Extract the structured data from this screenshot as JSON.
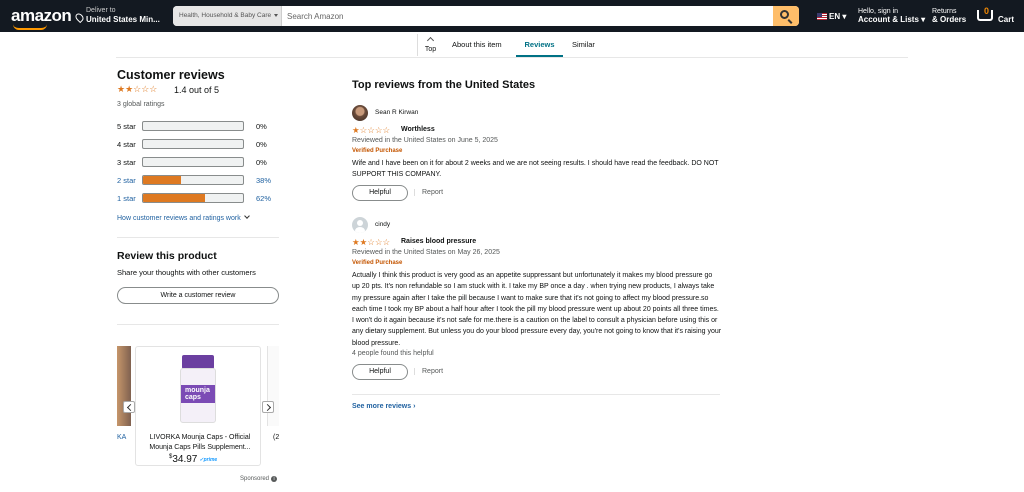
{
  "header": {
    "logo": "amazon",
    "deliver_line1": "Deliver to",
    "deliver_line2": "United States Min...",
    "search_category": "Health, Household & Baby Care",
    "search_placeholder": "Search Amazon",
    "language": "EN",
    "account_line1": "Hello, sign in",
    "account_line2": "Account & Lists",
    "orders_line1": "Returns",
    "orders_line2": "& Orders",
    "cart_count": "0",
    "cart_label": "Cart",
    "accent_color": "#febd69"
  },
  "tabs": {
    "top": "Top",
    "about": "About this item",
    "reviews": "Reviews",
    "similar": "Similar",
    "active": "Reviews"
  },
  "summary": {
    "title": "Customer reviews",
    "stars": "★★☆☆☆",
    "rating_text": "1.4 out of 5",
    "rating_value": 1.4,
    "global_ratings": "3 global ratings",
    "histogram": [
      {
        "label": "5 star",
        "pct_text": "0%",
        "pct": 0,
        "link": false
      },
      {
        "label": "4 star",
        "pct_text": "0%",
        "pct": 0,
        "link": false
      },
      {
        "label": "3 star",
        "pct_text": "0%",
        "pct": 0,
        "link": false
      },
      {
        "label": "2 star",
        "pct_text": "38%",
        "pct": 38,
        "link": true
      },
      {
        "label": "1 star",
        "pct_text": "62%",
        "pct": 62,
        "link": true
      }
    ],
    "how_link": "How customer reviews and ratings work"
  },
  "review_product": {
    "title": "Review this product",
    "subtitle": "Share your thoughts with other customers",
    "button": "Write a customer review"
  },
  "ad": {
    "left_fragment": "KA",
    "right_fragment": "(2",
    "product_title": "LIVORKA Mounja Caps - Official Mounja Caps Pills Supplement...",
    "bottle_text": "mounja caps",
    "price_symbol": "$",
    "price_whole": "34.97",
    "prime": "✓prime",
    "sponsored": "Sponsored"
  },
  "reviews": {
    "heading": "Top reviews from the United States",
    "items": [
      {
        "name": "Sean R Kirwan",
        "stars": "★☆☆☆☆",
        "rating": 1,
        "title": "Worthless",
        "date": "Reviewed in the United States on June 5, 2025",
        "verified": "Verified Purchase",
        "body": "Wife and I have been on it for about 2 weeks and we are not seeing results. I should have read the feedback. DO NOT SUPPORT THIS COMPANY.",
        "helpful_count": "",
        "helpful_label": "Helpful",
        "report_label": "Report"
      },
      {
        "name": "cindy",
        "stars": "★★☆☆☆",
        "rating": 2,
        "title": "Raises blood pressure",
        "date": "Reviewed in the United States on May 26, 2025",
        "verified": "Verified Purchase",
        "body": "Actually I think this product is very good as an appetite suppressant but unfortunately it makes my blood pressure go up 20 pts. It's non refundable so I am stuck with it. I take my BP once a day . when trying new products, I always take my pressure again after I take the pill because I want to make sure that it's not going to affect my blood pressure.so each time I took my BP about a half hour after I took the pill my blood pressure went up about 20 points all three times. I won't do it again because it's not safe for me.there is a caution on the label to consult a physician before using this or any dietary supplement. But unless you do your blood pressure every day, you're not going to know that it's raising your blood pressure.",
        "helpful_count": "4 people found this helpful",
        "helpful_label": "Helpful",
        "report_label": "Report"
      }
    ],
    "see_more": "See more reviews ›"
  }
}
